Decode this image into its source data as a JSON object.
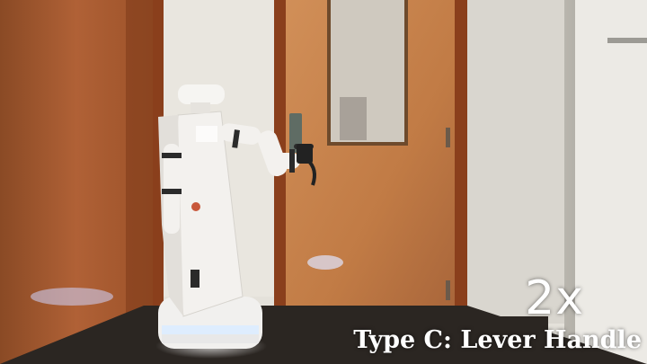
{
  "overlay": {
    "speed_label": "2x",
    "caption": "Type C: Lever Handle"
  },
  "colors": {
    "door_wood": "#c9844e",
    "door_frame": "#8a3f1c",
    "left_wall_wood": "#a5582f",
    "back_wall": "#e4e1da",
    "robot_white": "#f3f1ee",
    "floor": "#2b2622"
  }
}
